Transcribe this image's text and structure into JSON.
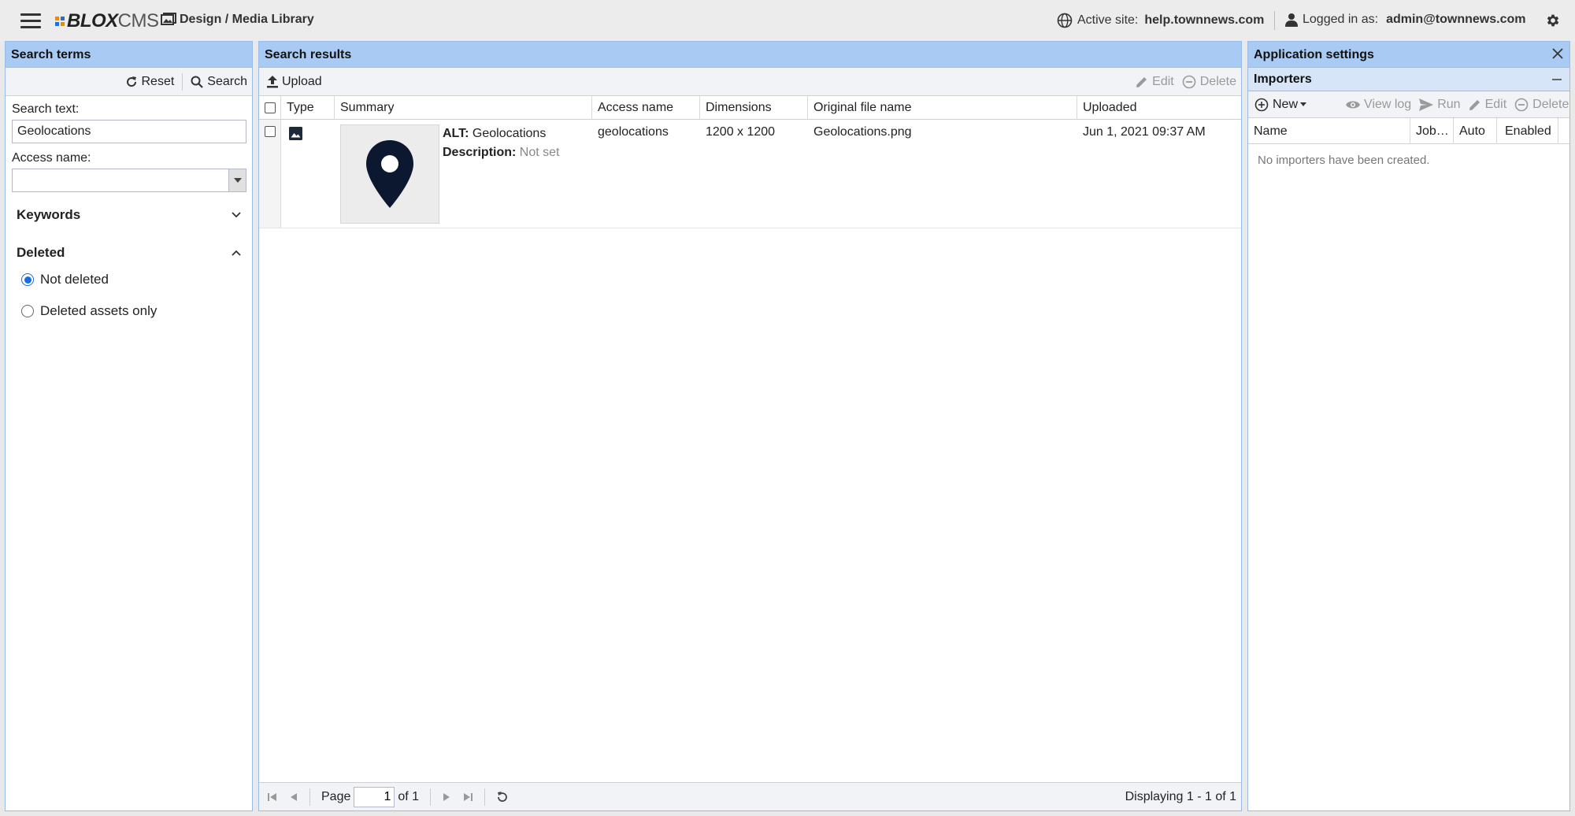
{
  "topbar": {
    "menu_icon": "hamburger-icon",
    "logo_blox": "BLOX",
    "logo_cms": "CMS",
    "breadcrumb": "Design / Media Library",
    "active_site_label": "Active site:",
    "active_site_value": "help.townnews.com",
    "logged_in_label": "Logged in as:",
    "logged_in_value": "admin@townnews.com"
  },
  "search_panel": {
    "title": "Search terms",
    "reset_label": "Reset",
    "search_label": "Search",
    "search_text_label": "Search text:",
    "search_text_value": "Geolocations",
    "access_name_label": "Access name:",
    "access_name_value": "",
    "keywords_label": "Keywords",
    "deleted_label": "Deleted",
    "radio_not_deleted": "Not deleted",
    "radio_deleted_only": "Deleted assets only",
    "selected_radio": "Not deleted"
  },
  "results_panel": {
    "title": "Search results",
    "upload_label": "Upload",
    "edit_label": "Edit",
    "delete_label": "Delete",
    "columns": [
      "Type",
      "Summary",
      "Access name",
      "Dimensions",
      "Original file name",
      "Uploaded"
    ],
    "rows": [
      {
        "alt_label": "ALT:",
        "alt_value": "Geolocations",
        "description_label": "Description:",
        "description_value": "Not set",
        "access_name": "geolocations",
        "dimensions": "1200 x 1200",
        "original_file_name": "Geolocations.png",
        "uploaded": "Jun 1, 2021 09:37 AM"
      }
    ],
    "pager": {
      "page_label": "Page",
      "page_value": "1",
      "of_label": "of 1",
      "displaying": "Displaying 1 - 1 of 1"
    }
  },
  "settings_panel": {
    "title": "Application settings",
    "importers_title": "Importers",
    "new_label": "New",
    "view_log_label": "View log",
    "run_label": "Run",
    "edit_label": "Edit",
    "delete_label": "Delete",
    "columns": [
      "Name",
      "Job…",
      "Auto",
      "Enabled"
    ],
    "empty_message": "No importers have been created."
  },
  "colors": {
    "header_blue": "#a9cbf3",
    "subheader_blue": "#d6e6f8",
    "radio_blue": "#1a6cd8",
    "logo_orange": "#f08a00",
    "logo_blue": "#1f6fd6"
  }
}
